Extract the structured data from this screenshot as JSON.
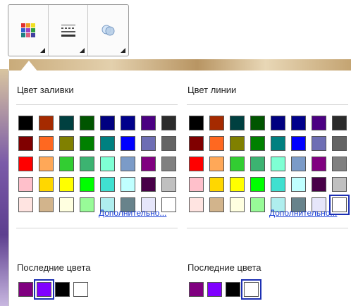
{
  "toolbar": {
    "buttons": [
      {
        "name": "fill-color-button",
        "icon": "color-grid-icon"
      },
      {
        "name": "line-style-button",
        "icon": "line-weight-icon"
      },
      {
        "name": "effects-button",
        "icon": "shape-effects-icon"
      }
    ]
  },
  "fill": {
    "title": "Цвет заливки",
    "more_link": "Дополнительно...",
    "recent_title": "Последние цвета",
    "palette": [
      "#000000",
      "#a52a00",
      "#004040",
      "#005500",
      "#000080",
      "#00008b",
      "#4b0082",
      "#2b2b2b",
      "#800000",
      "#ff6820",
      "#808000",
      "#008000",
      "#008080",
      "#0000ff",
      "#6e6eb4",
      "#646464",
      "#ff0000",
      "#ffa858",
      "#32cd32",
      "#3cb371",
      "#7fffd4",
      "#7b9bc8",
      "#800080",
      "#808080",
      "#ffc0cb",
      "#ffd700",
      "#ffff00",
      "#00ff00",
      "#40e0d0",
      "#c0ffff",
      "#480048",
      "#c0c0c0",
      "#ffe4e1",
      "#d2b48c",
      "#ffffe0",
      "#98fb98",
      "#afeeee",
      "#68838b",
      "#e6e6fa",
      "#ffffff"
    ],
    "recent": [
      "#800080",
      "#8000ff",
      "#000000",
      "#ffffff"
    ],
    "selected_recent_index": 1,
    "selected_palette_index": -1
  },
  "line": {
    "title": "Цвет линии",
    "more_link": "Дополнительно...",
    "recent_title": "Последние цвета",
    "palette": [
      "#000000",
      "#a52a00",
      "#004040",
      "#005500",
      "#000080",
      "#00008b",
      "#4b0082",
      "#2b2b2b",
      "#800000",
      "#ff6820",
      "#808000",
      "#008000",
      "#008080",
      "#0000ff",
      "#6e6eb4",
      "#646464",
      "#ff0000",
      "#ffa858",
      "#32cd32",
      "#3cb371",
      "#7fffd4",
      "#7b9bc8",
      "#800080",
      "#808080",
      "#ffc0cb",
      "#ffd700",
      "#ffff00",
      "#00ff00",
      "#40e0d0",
      "#c0ffff",
      "#480048",
      "#c0c0c0",
      "#ffe4e1",
      "#d2b48c",
      "#ffffe0",
      "#98fb98",
      "#afeeee",
      "#68838b",
      "#e6e6fa",
      "#ffffff"
    ],
    "recent": [
      "#800080",
      "#8000ff",
      "#000000",
      "#ffffff"
    ],
    "selected_recent_index": 3,
    "selected_palette_index": 39
  }
}
